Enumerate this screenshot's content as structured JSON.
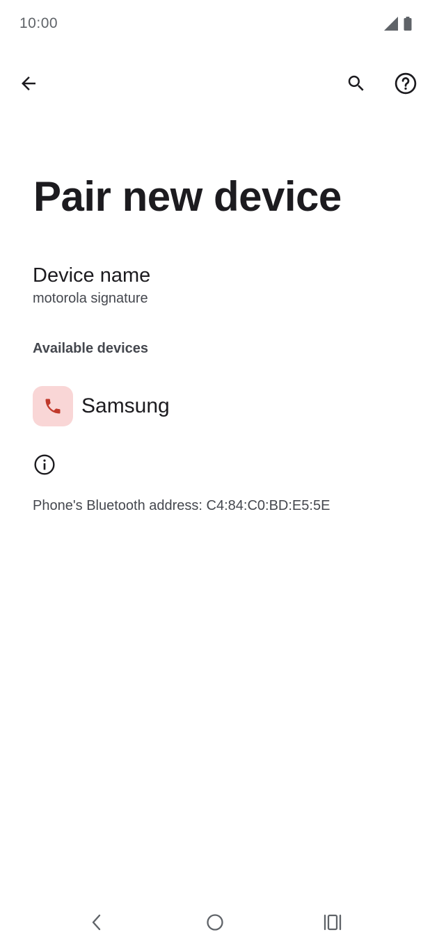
{
  "status_bar": {
    "time": "10:00",
    "icons": [
      "signal-icon",
      "battery-icon"
    ]
  },
  "top_bar": {
    "back_icon": "arrow-back-icon",
    "search_icon": "search-icon",
    "help_icon": "help-icon"
  },
  "page": {
    "title": "Pair new device"
  },
  "device_name": {
    "title": "Device name",
    "value": "motorola signature"
  },
  "available_devices": {
    "header": "Available devices",
    "items": [
      {
        "label": "Samsung",
        "icon": "phone-icon",
        "icon_bg": "#f9d6d6",
        "icon_color": "#c0392b"
      }
    ]
  },
  "info": {
    "icon": "info-icon",
    "bluetooth_address": "Phone's Bluetooth address: C4:84:C0:BD:E5:5E"
  },
  "nav_bar": {
    "icons": [
      "nav-back-icon",
      "nav-home-icon",
      "nav-recents-icon"
    ]
  }
}
